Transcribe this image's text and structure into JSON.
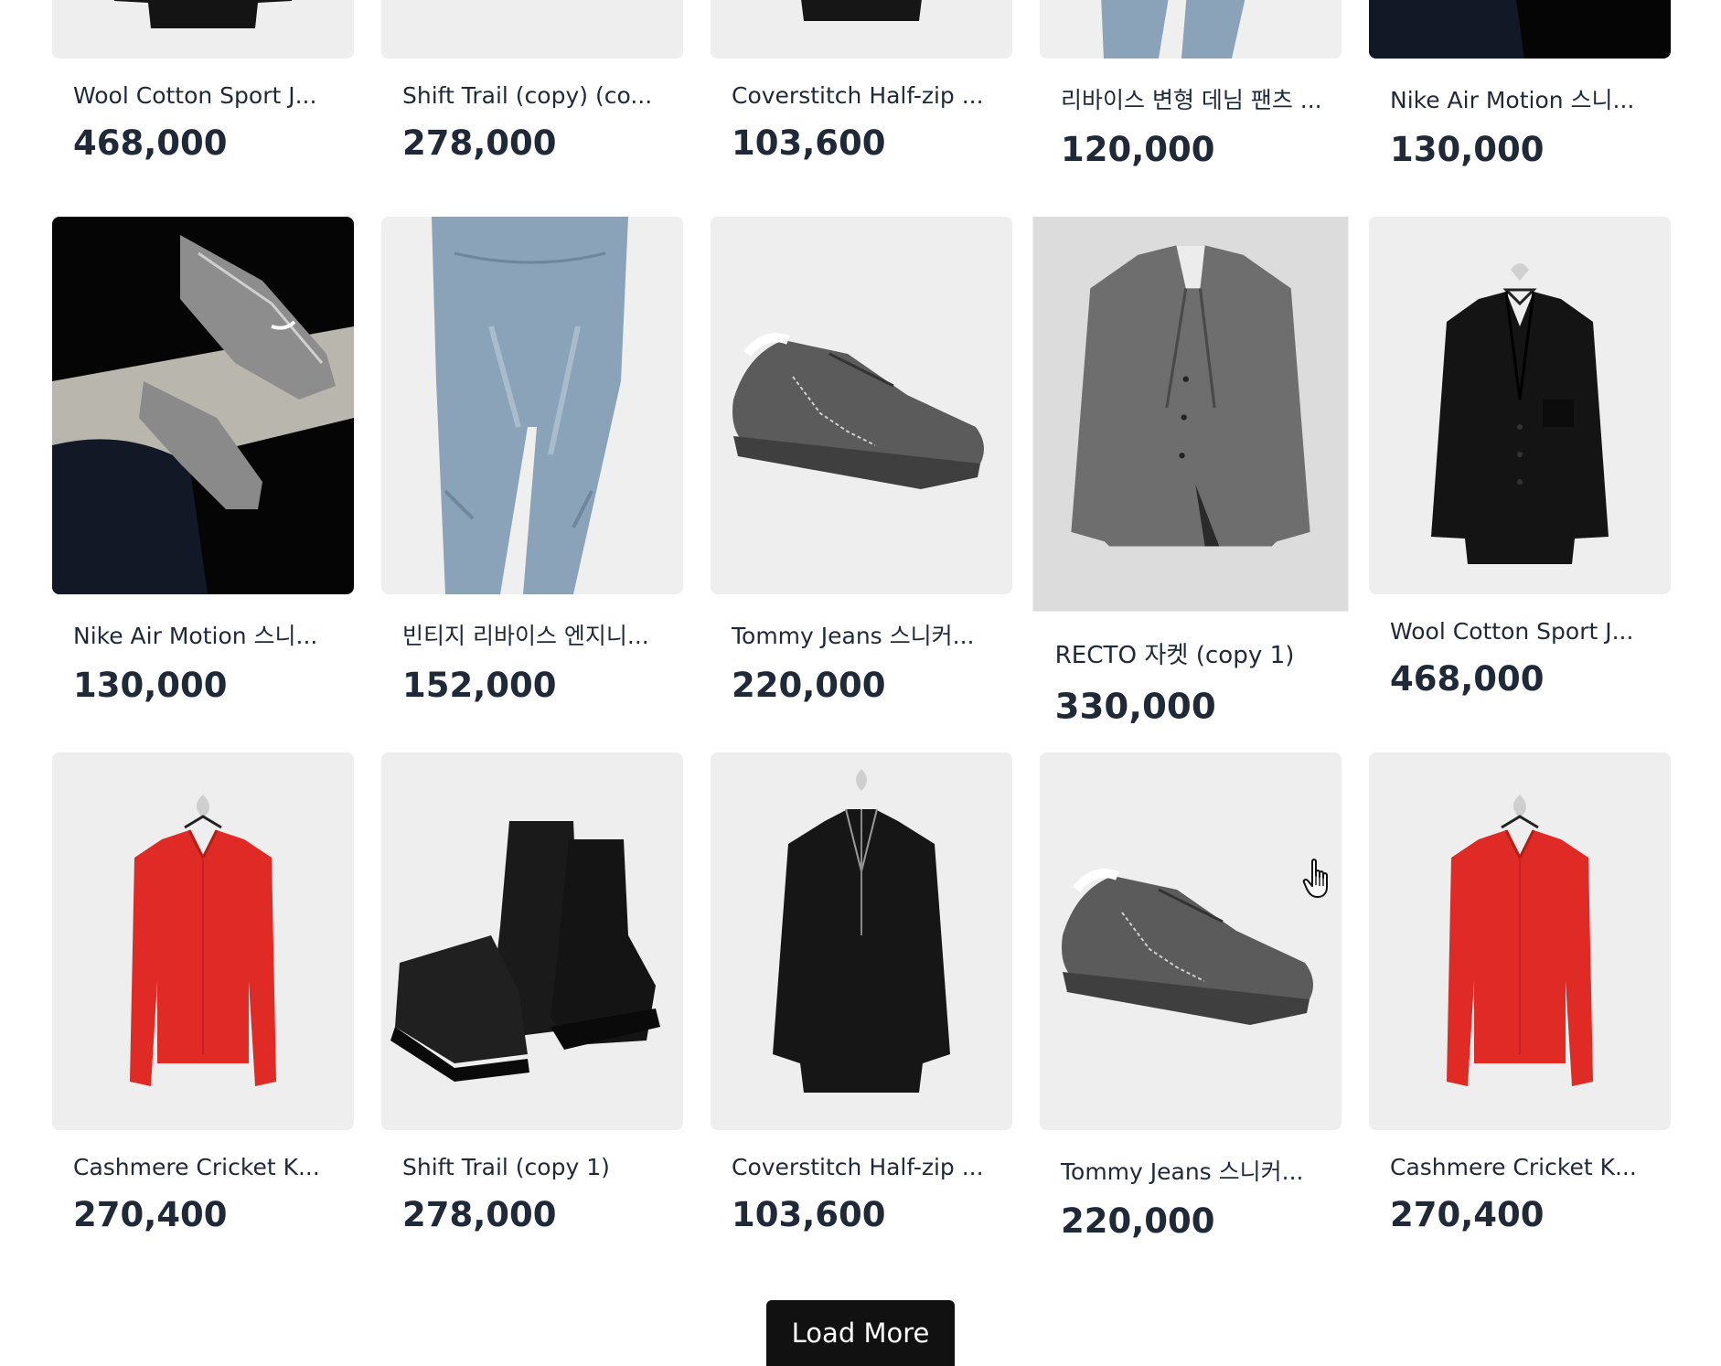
{
  "products": [
    {
      "name": "Wool Cotton Sport J...",
      "price": "468,000",
      "image": "black-blazer"
    },
    {
      "name": "Shift Trail (copy) (co...",
      "price": "278,000",
      "image": "blank"
    },
    {
      "name": "Coverstitch Half-zip ...",
      "price": "103,600",
      "image": "black-halfzip"
    },
    {
      "name": "리바이스 변형 데님 팬츠 ...",
      "price": "120,000",
      "image": "denim-pants"
    },
    {
      "name": "Nike Air Motion 스니...",
      "price": "130,000",
      "image": "nike-sneaker"
    },
    {
      "name": "Nike Air Motion 스니...",
      "price": "130,000",
      "image": "nike-sneaker"
    },
    {
      "name": "빈티지 리바이스 엔지니...",
      "price": "152,000",
      "image": "denim-pants"
    },
    {
      "name": "Tommy Jeans 스니커...",
      "price": "220,000",
      "image": "grey-sneaker"
    },
    {
      "name": "RECTO 자켓 (copy 1)",
      "price": "330,000",
      "image": "tweed-jacket"
    },
    {
      "name": "Wool Cotton Sport J...",
      "price": "468,000",
      "image": "black-blazer"
    },
    {
      "name": "Cashmere Cricket K...",
      "price": "270,400",
      "image": "red-sweater"
    },
    {
      "name": "Shift Trail (copy 1)",
      "price": "278,000",
      "image": "black-boots"
    },
    {
      "name": "Coverstitch Half-zip ...",
      "price": "103,600",
      "image": "black-halfzip"
    },
    {
      "name": "Tommy Jeans 스니커...",
      "price": "220,000",
      "image": "grey-sneaker"
    },
    {
      "name": "Cashmere Cricket K...",
      "price": "270,400",
      "image": "red-sweater"
    }
  ],
  "load_more": {
    "label": "Load More"
  },
  "cursor": {
    "icon": "hand-pointer-icon"
  },
  "colors": {
    "text": "#1f2937",
    "button_bg": "#111111",
    "button_text": "#ffffff",
    "thumb_bg": "#eeeeee"
  }
}
